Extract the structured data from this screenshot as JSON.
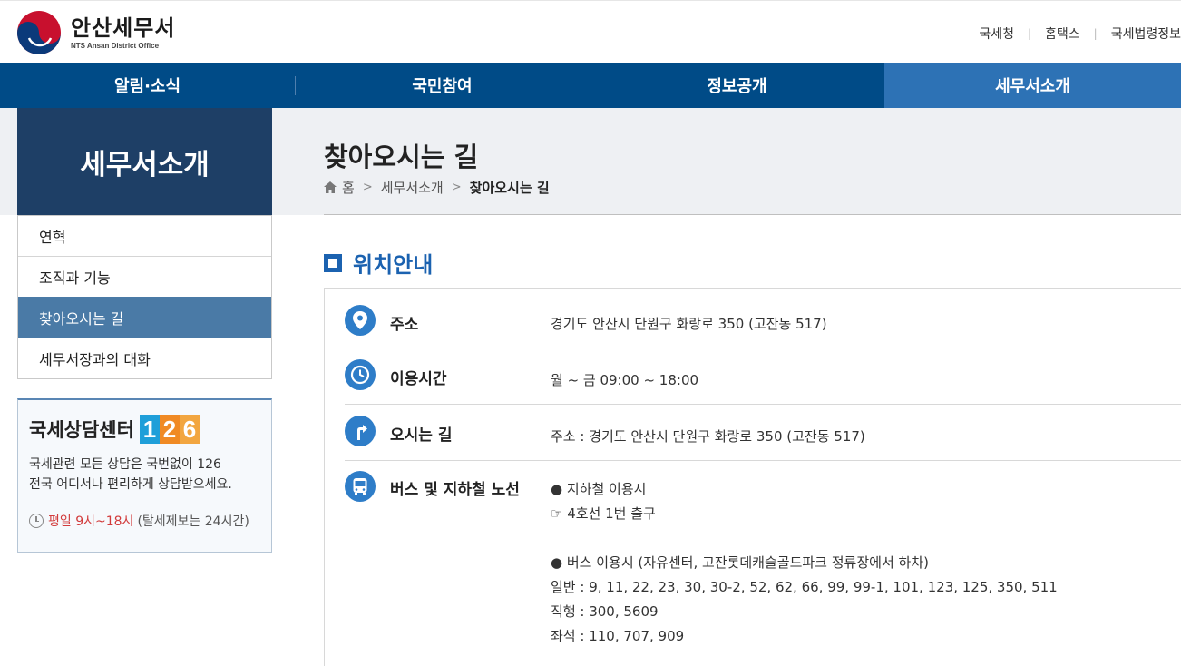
{
  "header": {
    "logo_title": "안산세무서",
    "logo_sub": "NTS Ansan District Office",
    "util_links": [
      "국세청",
      "홈택스",
      "국세법령정보"
    ]
  },
  "nav": {
    "items": [
      "알림·소식",
      "국민참여",
      "정보공개",
      "세무서소개"
    ],
    "active_index": 3
  },
  "sidebar": {
    "title": "세무서소개",
    "menu": [
      "연혁",
      "조직과 기능",
      "찾아오시는 길",
      "세무서장과의 대화"
    ],
    "active_index": 2
  },
  "call_center": {
    "title": "국세상담센터",
    "number_digits": [
      "1",
      "2",
      "6"
    ],
    "desc_line1": "국세관련 모든 상담은 국번없이 126",
    "desc_line2": "전국 어디서나 편리하게 상담받으세요.",
    "hours_red": "평일 9시~18시",
    "hours_rest": "(탈세제보는 24시간)"
  },
  "page": {
    "title": "찾아오시는 길",
    "breadcrumb": [
      "홈",
      "세무서소개",
      "찾아오시는 길"
    ]
  },
  "section": {
    "title": "위치안내",
    "rows": {
      "address": {
        "label": "주소",
        "value": "경기도 안산시 단원구 화랑로 350 (고잔동 517)",
        "icon": "location-pin-icon"
      },
      "hours": {
        "label": "이용시간",
        "value": "월 ~ 금 09:00 ~ 18:00",
        "icon": "clock-icon"
      },
      "directions": {
        "label": "오시는 길",
        "value": "주소 : 경기도 안산시 단원구 화랑로 350 (고잔동 517)",
        "icon": "directions-sign-icon"
      },
      "transit": {
        "label": "버스 및 지하철 노선",
        "icon": "bus-icon",
        "subway_head": "● 지하철 이용시",
        "subway_line": "☞ 4호선 1번 출구",
        "bus_head": "● 버스 이용시 (자유센터, 고잔롯데캐슬골드파크 정류장에서 하차)",
        "bus_general": "일반 : 9, 11, 22, 23, 30, 30-2, 52, 62, 66, 99, 99-1, 101, 123, 125, 350, 511",
        "bus_express": "직행 : 300, 5609",
        "bus_seat": "좌석 : 110, 707, 909"
      }
    }
  },
  "colors": {
    "nav_bg": "#004b87",
    "nav_active": "#2d72b5",
    "sidebar_title_bg": "#1e3f66",
    "sidebar_active": "#4a7aa6",
    "accent_blue": "#1b62b0",
    "icon_blue": "#2e7dc8"
  }
}
